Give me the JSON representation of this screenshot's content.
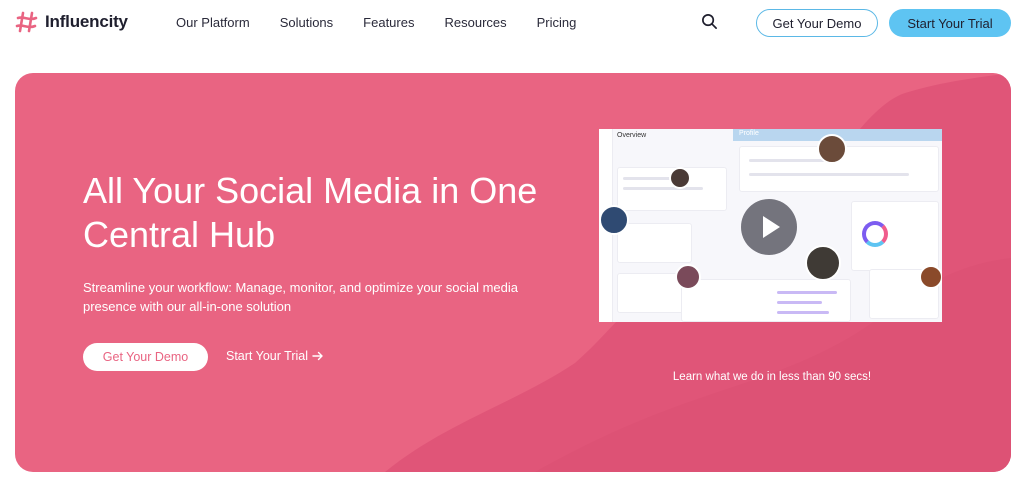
{
  "brand": {
    "name": "Influencity",
    "accent": "#e96482",
    "sky": "#5ec4f2"
  },
  "nav": {
    "items": [
      "Our Platform",
      "Solutions",
      "Features",
      "Resources",
      "Pricing"
    ],
    "search_icon": "search-icon",
    "demo_label": "Get Your Demo",
    "trial_label": "Start Your Trial"
  },
  "hero": {
    "title": "All Your Social Media in One Central Hub",
    "subtitle": "Streamline your workflow: Manage, monitor, and optimize your social media presence with our all-in-one solution",
    "demo_label": "Get Your Demo",
    "trial_label": "Start Your Trial",
    "video_caption": "Learn what we do in less than 90 secs!"
  },
  "mockup": {
    "overview_label": "Overview",
    "profile_label": "Profile"
  }
}
